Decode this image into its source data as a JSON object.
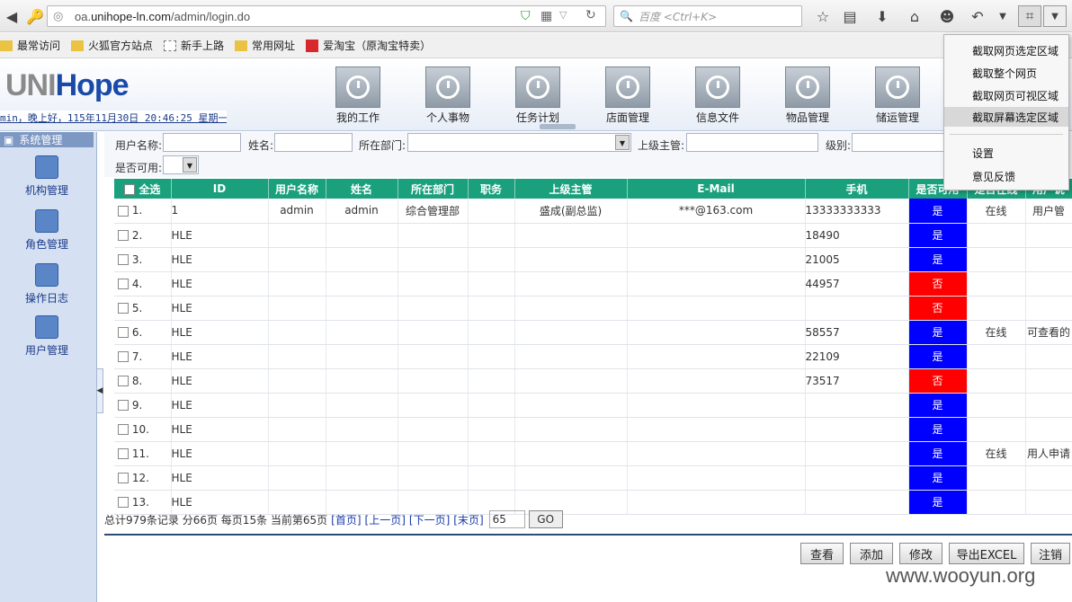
{
  "browser": {
    "url_prefix": "oa.",
    "url_domain": "unihope-ln.com",
    "url_path": "/admin/login.do",
    "search_placeholder": "百度 <Ctrl+K>",
    "bookmarks": [
      "最常访问",
      "火狐官方站点",
      "新手上路",
      "常用网址",
      "爱淘宝（原淘宝特卖）"
    ]
  },
  "screenshot_menu": {
    "items": [
      "截取网页选定区域",
      "截取整个网页",
      "截取网页可视区域",
      "截取屏幕选定区域"
    ],
    "items2": [
      "设置",
      "意见反馈"
    ]
  },
  "app": {
    "logo": "UNIHope",
    "greeting": "min，晚上好，115年11月30日 20:46:25 星期一",
    "nav": [
      "我的工作",
      "个人事物",
      "任务计划",
      "店面管理",
      "信息文件",
      "物品管理",
      "储运管理"
    ],
    "sidebar_title": "系统管理",
    "sidebar_items": [
      "机构管理",
      "角色管理",
      "操作日志",
      "用户管理"
    ]
  },
  "filters": {
    "username_label": "用户名称:",
    "name_label": "姓名:",
    "dept_label": "所在部门:",
    "supervisor_label": "上级主管:",
    "level_label": "级别:",
    "available_label": "是否可用:"
  },
  "table": {
    "headers": [
      "全选",
      "ID",
      "用户名称",
      "姓名",
      "所在部门",
      "职务",
      "上级主管",
      "E-Mail",
      "手机",
      "是否可用",
      "是否在线",
      "用户说"
    ],
    "rows": [
      {
        "n": "1.",
        "id": "1",
        "user": "admin",
        "name": "admin",
        "dept": "综合管理部",
        "title": "",
        "sup": "盛成(副总监)",
        "mail": "***@163.com",
        "phone": "13333333333",
        "avail": "是",
        "online": "在线",
        "note": "用户管"
      },
      {
        "n": "2.",
        "id": "HLE",
        "user": "",
        "name": "",
        "dept": "",
        "title": "",
        "sup": "",
        "mail": "",
        "phone": "18490",
        "avail": "是",
        "online": "",
        "note": ""
      },
      {
        "n": "3.",
        "id": "HLE",
        "user": "",
        "name": "",
        "dept": "",
        "title": "",
        "sup": "",
        "mail": "",
        "phone": "21005",
        "avail": "是",
        "online": "",
        "note": ""
      },
      {
        "n": "4.",
        "id": "HLE",
        "user": "",
        "name": "",
        "dept": "",
        "title": "",
        "sup": "",
        "mail": "",
        "phone": "44957",
        "avail": "否",
        "online": "",
        "note": ""
      },
      {
        "n": "5.",
        "id": "HLE",
        "user": "",
        "name": "",
        "dept": "",
        "title": "",
        "sup": "",
        "mail": "",
        "phone": "",
        "avail": "否",
        "online": "",
        "note": ""
      },
      {
        "n": "6.",
        "id": "HLE",
        "user": "",
        "name": "",
        "dept": "",
        "title": "",
        "sup": "",
        "mail": "",
        "phone": "58557",
        "avail": "是",
        "online": "在线",
        "note": "可查看的"
      },
      {
        "n": "7.",
        "id": "HLE",
        "user": "",
        "name": "",
        "dept": "",
        "title": "",
        "sup": "",
        "mail": "",
        "phone": "22109",
        "avail": "是",
        "online": "",
        "note": ""
      },
      {
        "n": "8.",
        "id": "HLE",
        "user": "",
        "name": "",
        "dept": "",
        "title": "",
        "sup": "",
        "mail": "",
        "phone": "73517",
        "avail": "否",
        "online": "",
        "note": ""
      },
      {
        "n": "9.",
        "id": "HLE",
        "user": "",
        "name": "",
        "dept": "",
        "title": "",
        "sup": "",
        "mail": "",
        "phone": "",
        "avail": "是",
        "online": "",
        "note": ""
      },
      {
        "n": "10.",
        "id": "HLE",
        "user": "",
        "name": "",
        "dept": "",
        "title": "",
        "sup": "",
        "mail": "",
        "phone": "",
        "avail": "是",
        "online": "",
        "note": ""
      },
      {
        "n": "11.",
        "id": "HLE",
        "user": "",
        "name": "",
        "dept": "",
        "title": "",
        "sup": "",
        "mail": "",
        "phone": "",
        "avail": "是",
        "online": "在线",
        "note": "用人申请"
      },
      {
        "n": "12.",
        "id": "HLE",
        "user": "",
        "name": "",
        "dept": "",
        "title": "",
        "sup": "",
        "mail": "",
        "phone": "",
        "avail": "是",
        "online": "",
        "note": ""
      },
      {
        "n": "13.",
        "id": "HLE",
        "user": "",
        "name": "",
        "dept": "",
        "title": "",
        "sup": "",
        "mail": "",
        "phone": "",
        "avail": "是",
        "online": "",
        "note": ""
      }
    ]
  },
  "pager": {
    "summary": "总计979条记录 分66页 每页15条 当前第65页",
    "first": "[首页]",
    "prev": "[上一页]",
    "next": "[下一页]",
    "last": "[末页]",
    "page_value": "65",
    "go": "GO"
  },
  "actions": [
    "查看",
    "添加",
    "修改",
    "导出EXCEL",
    "注销"
  ],
  "watermark": "www.wooyun.org",
  "colors": {
    "header_green": "#1aa07d",
    "yes_blue": "#0000ff",
    "no_red": "#ff0000",
    "logo_grey": "#8a8a8a",
    "logo_blue": "#1a4aa8"
  }
}
